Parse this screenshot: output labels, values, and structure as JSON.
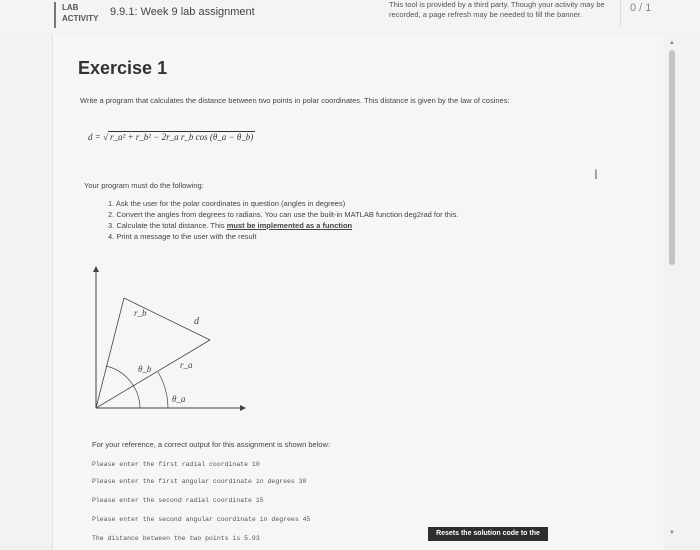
{
  "header": {
    "lab_line1": "LAB",
    "lab_line2": "ACTIVITY",
    "title": "9.9.1: Week 9 lab assignment",
    "third_party_line1": "This tool is provided by a third party. Though your activity may be",
    "third_party_line2": "recorded, a page refresh may be needed to fill the banner.",
    "score": "0 / 1"
  },
  "content": {
    "heading": "Exercise 1",
    "description": "Write a program that calculates the distance between two points in polar coordinates. This distance is given by the law of cosines:",
    "formula_lhs": "d = ",
    "formula_rhs": "r_a² + r_b² − 2r_a r_b cos (θ_a − θ_b)",
    "must_do": "Your program must do the following:",
    "steps": [
      "1. Ask the user for the polar coordinates in question (angles in degrees)",
      "2. Convert the angles from degrees to radians. You can use the built-in MATLAB function deg2rad for this.",
      "3. Calculate the total distance. This ",
      "4. Print a message to the user with the result"
    ],
    "step3_emphasis": "must be implemented as a function",
    "diagram_labels": {
      "rb": "r_b",
      "d": "d",
      "ra": "r_a",
      "theta_b": "θ_b",
      "theta_a": "θ_a"
    },
    "reference_text": "For your reference, a correct output for this assignment is shown below:",
    "sample_output": [
      "Please enter the first radial coordinate 10",
      "Please enter the first angular coordinate in degrees 30",
      "Please enter the second radial coordinate 15",
      "Please enter the second angular coordinate in degrees 45",
      "The distance between the two points is 5.93"
    ],
    "reset_button": "Resets the solution code to the"
  },
  "icons": {
    "scroll_up": "▲",
    "scroll_down": "▼",
    "text_cursor": "I"
  }
}
